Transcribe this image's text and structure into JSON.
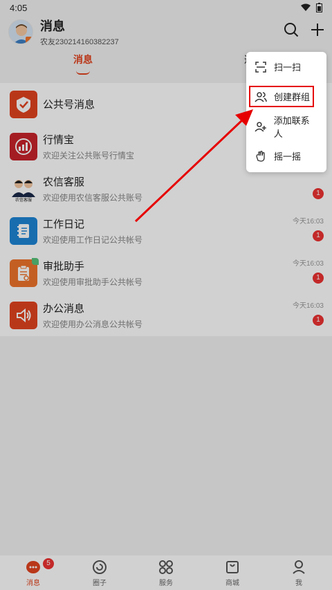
{
  "status": {
    "time": "4:05"
  },
  "header": {
    "title": "消息",
    "subtitle": "农友230214160382237"
  },
  "tabs": [
    {
      "label": "消息"
    },
    {
      "label": "通"
    }
  ],
  "messages": [
    {
      "title": "公共号消息",
      "subtitle": "",
      "time": "",
      "badge": ""
    },
    {
      "title": "行情宝",
      "subtitle": "欢迎关注公共账号行情宝",
      "time": "",
      "badge": ""
    },
    {
      "title": "农信客服",
      "subtitle": "欢迎使用农信客服公共账号",
      "time": "",
      "badge": "1",
      "icon_label": "农信客服"
    },
    {
      "title": "工作日记",
      "subtitle": "欢迎使用工作日记公共帐号",
      "time": "今天16:03",
      "badge": "1"
    },
    {
      "title": "审批助手",
      "subtitle": "欢迎使用审批助手公共帐号",
      "time": "今天16:03",
      "badge": "1"
    },
    {
      "title": "办公消息",
      "subtitle": "欢迎使用办公消息公共帐号",
      "time": "今天16:03",
      "badge": "1"
    }
  ],
  "menu": [
    {
      "label": "扫一扫"
    },
    {
      "label": "创建群组"
    },
    {
      "label": "添加联系人"
    },
    {
      "label": "摇一摇"
    }
  ],
  "nav": [
    {
      "label": "消息",
      "badge": "5"
    },
    {
      "label": "圈子"
    },
    {
      "label": "服务"
    },
    {
      "label": "商城"
    },
    {
      "label": "我"
    }
  ],
  "colors": {
    "accent": "#e2441f",
    "highlight": "#e60000"
  }
}
